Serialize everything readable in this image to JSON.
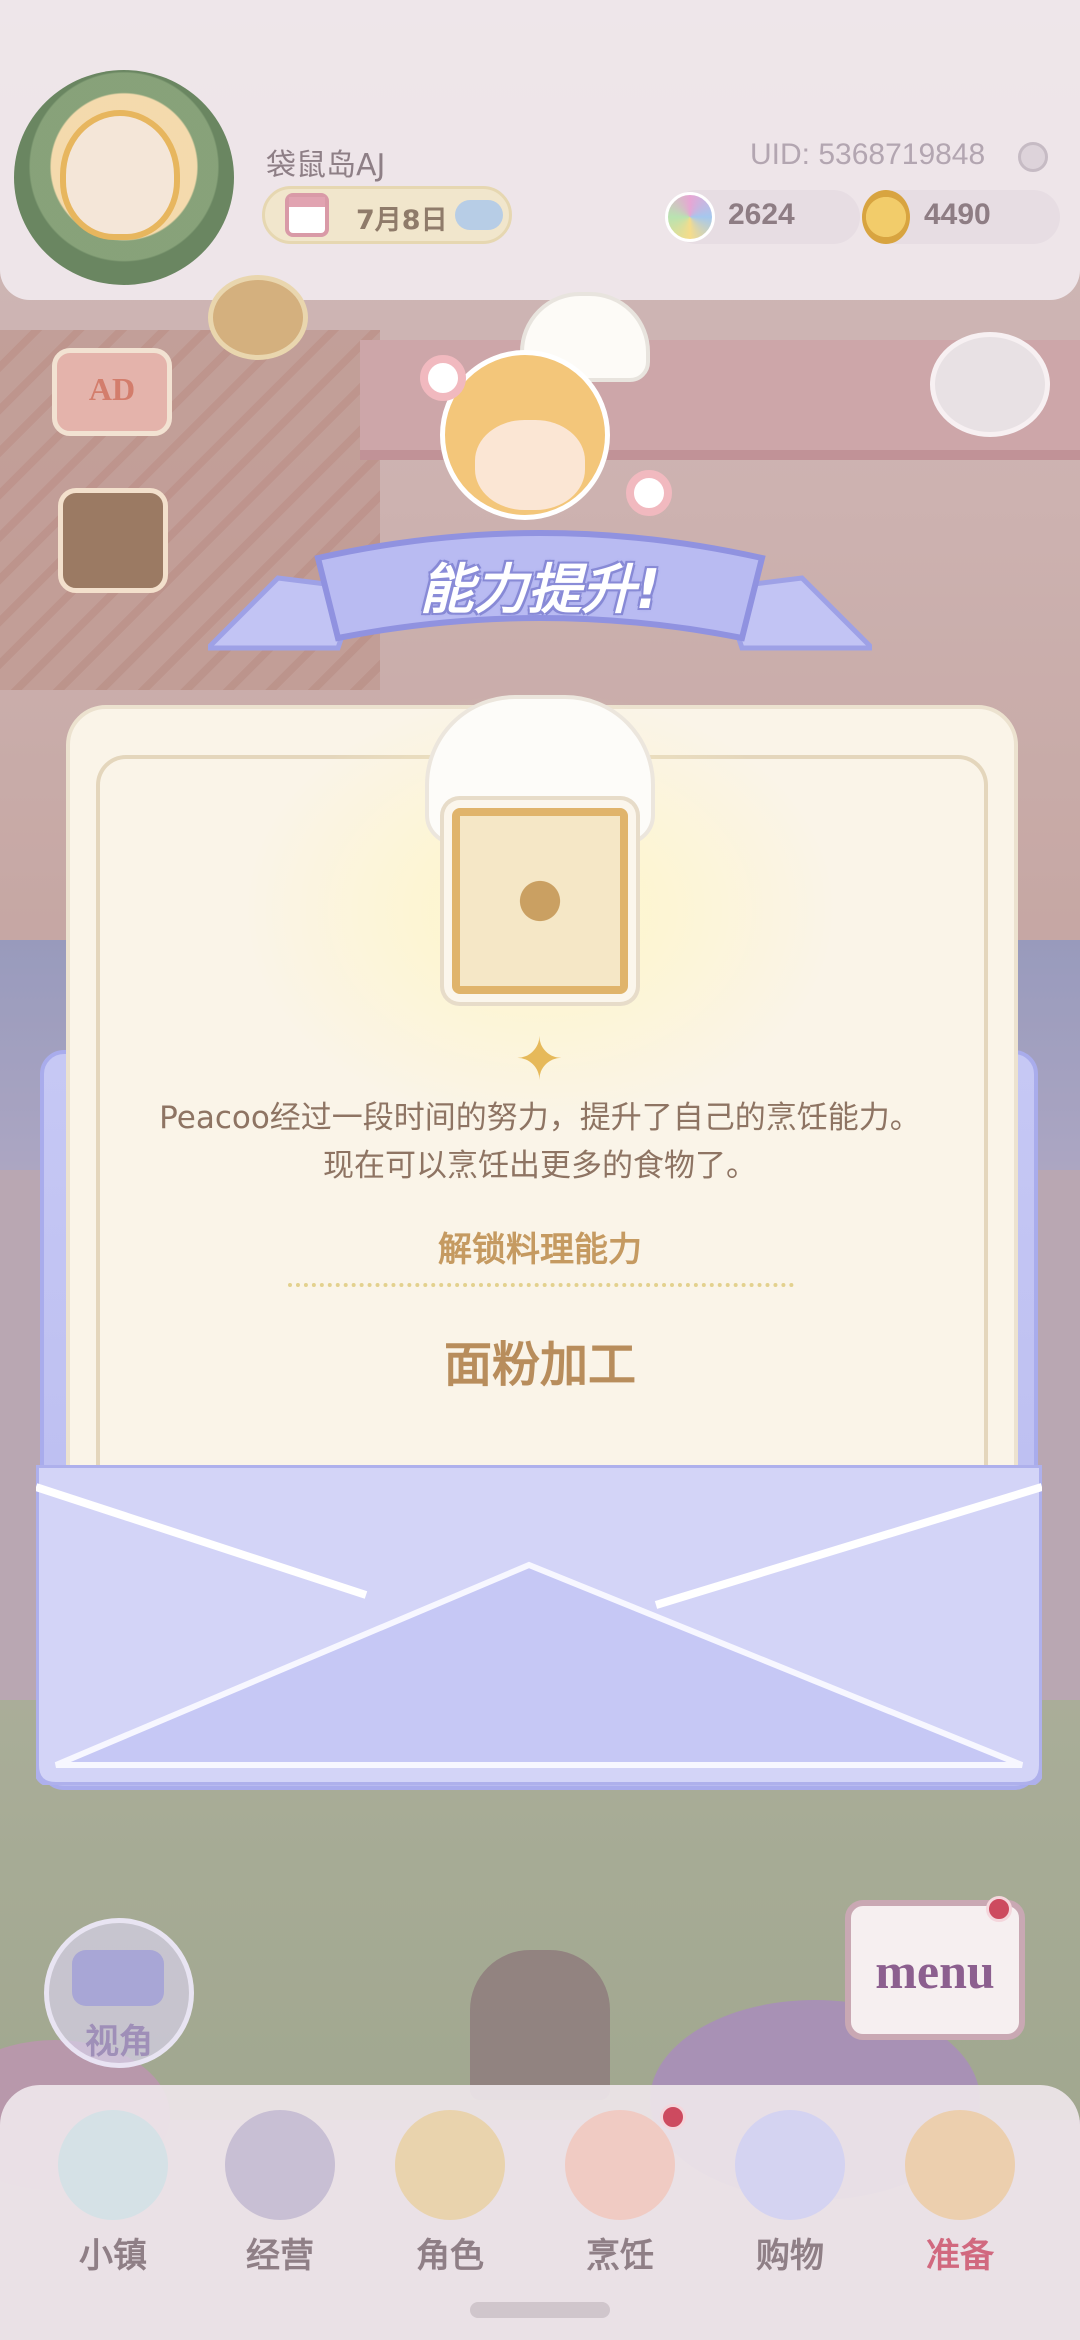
{
  "header": {
    "player_name": "袋鼠岛AJ",
    "uid": "UID: 5368719848",
    "date": "7月8日",
    "gems": "2624",
    "coins": "4490"
  },
  "side": {
    "ad_label": "AD"
  },
  "dialog": {
    "title": "能力提升!",
    "description_line1": "Peacoo经过一段时间的努力，提升了自己的烹饪能力。",
    "description_line2": "现在可以烹饪出更多的食物了。",
    "unlock_label": "解锁料理能力",
    "skill_name": "面粉加工"
  },
  "bottom": {
    "view_label": "视角",
    "menu_label": "menu",
    "nav": [
      {
        "label": "小镇",
        "icon": "map-icon"
      },
      {
        "label": "经营",
        "icon": "locked-hat-icon"
      },
      {
        "label": "角色",
        "icon": "character-icon"
      },
      {
        "label": "烹饪",
        "icon": "cooking-icon"
      },
      {
        "label": "购物",
        "icon": "shopping-bag-icon"
      },
      {
        "label": "准备",
        "icon": "basket-icon",
        "active": true
      }
    ]
  },
  "colors": {
    "accent_active": "#d1697f",
    "ribbon": "#b9bbf2",
    "envelope": "#c6c8f4",
    "skill_text": "#b88d5c"
  }
}
